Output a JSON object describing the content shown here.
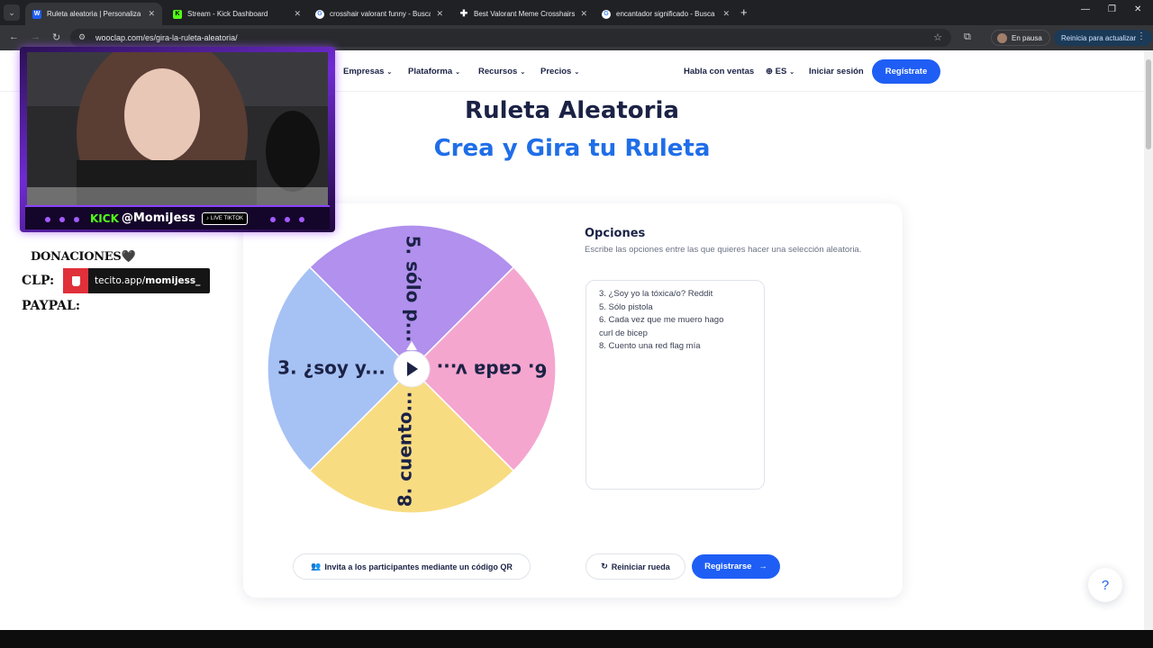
{
  "browser": {
    "tabs": [
      {
        "title": "Ruleta aleatoria | Personaliza y g",
        "icon": "wooclap-w",
        "active": true
      },
      {
        "title": "Stream - Kick Dashboard",
        "icon": "kick-k",
        "active": false
      },
      {
        "title": "crosshair valorant funny - Busca",
        "icon": "google-g",
        "active": false
      },
      {
        "title": "Best Valorant Meme Crosshairs",
        "icon": "plus-favicon",
        "active": false
      },
      {
        "title": "encantador significado - Busca",
        "icon": "google-g",
        "active": false
      }
    ],
    "url": "wooclap.com/es/gira-la-ruleta-aleatoria/",
    "pause_label": "En pausa",
    "update_label": "Reinicia para actualizar"
  },
  "site": {
    "nav": {
      "items": [
        "Empresas",
        "Plataforma",
        "Recursos",
        "Precios"
      ],
      "sales": "Habla con ventas",
      "lang": "ES",
      "login": "Iniciar sesión",
      "register": "Regístrate"
    },
    "title": "Ruleta Aleatoria",
    "subtitle": "Crea y Gira tu Ruleta",
    "wheel": {
      "segments": [
        {
          "label": "5. sólo p...",
          "color": "#b190ee"
        },
        {
          "label": "6. cada v...",
          "color": "#f4a6cf"
        },
        {
          "label": "8. cuento...",
          "color": "#f8dc82"
        },
        {
          "label": "3. ¿soy y...",
          "color": "#a6c1f4"
        }
      ]
    },
    "options": {
      "title": "Opciones",
      "description": "Escribe las opciones entre las que quieres hacer una selección aleatoria.",
      "lines": [
        "3. ¿Soy yo la tóxica/o? Reddit",
        "5. Sólo pistola",
        "6. Cada vez que me muero hago",
        "curl de bicep",
        "8. Cuento una red flag mía"
      ]
    },
    "buttons": {
      "invite": "Invita a los participantes mediante un código QR",
      "reset": "Reiniciar rueda",
      "register": "Registrarse"
    },
    "help": "?"
  },
  "overlay": {
    "kick": "KICK",
    "handle": "@MomiJess",
    "live_badge": "LIVE TIKTOK",
    "donations": "DONACIONES🖤",
    "clp_label": "CLP:",
    "tecito_prefix": "tecito.app/",
    "tecito_user": "momijess_",
    "paypal_label": "PAYPAL:"
  },
  "colors": {
    "brand_blue": "#1f5ef5",
    "title_navy": "#1b2245",
    "subtitle_blue": "#1f6ee8",
    "kick_green": "#53fc18",
    "overlay_purple": "#8a42ff"
  }
}
